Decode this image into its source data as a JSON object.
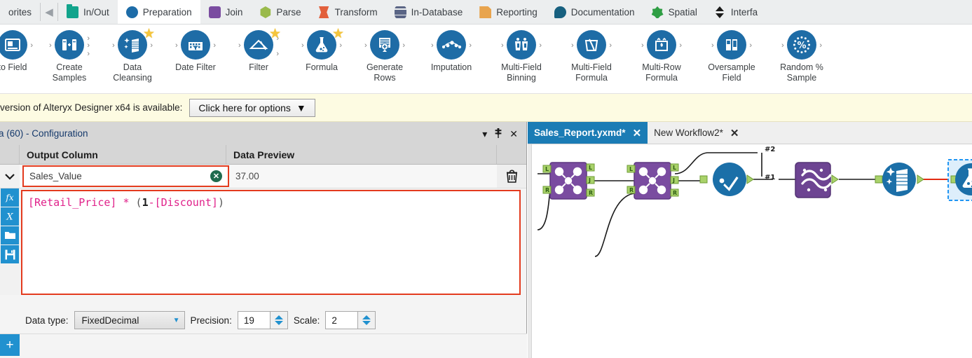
{
  "tool_palette": {
    "scroll_left_label": "◀",
    "categories": [
      {
        "label": "orites",
        "icon": "favorites-star-icon",
        "shape": "none",
        "active": false,
        "truncated": true
      },
      {
        "label": "In/Out",
        "icon": "folder-icon",
        "shape": "g-folder",
        "active": false
      },
      {
        "label": "Preparation",
        "icon": "circle-icon",
        "shape": "g-circle-blue",
        "active": true
      },
      {
        "label": "Join",
        "icon": "square-icon",
        "shape": "g-square-purple",
        "active": false
      },
      {
        "label": "Parse",
        "icon": "hexagon-icon",
        "shape": "g-hex-green",
        "active": false
      },
      {
        "label": "Transform",
        "icon": "hourglass-icon",
        "shape": "g-transform",
        "active": false
      },
      {
        "label": "In-Database",
        "icon": "database-icon",
        "shape": "g-db",
        "active": false
      },
      {
        "label": "Reporting",
        "icon": "page-icon",
        "shape": "g-report",
        "active": false
      },
      {
        "label": "Documentation",
        "icon": "speech-bubble-icon",
        "shape": "g-speech",
        "active": false
      },
      {
        "label": "Spatial",
        "icon": "globe-icon",
        "shape": "g-spatial",
        "active": false
      },
      {
        "label": "Interfa",
        "icon": "updown-arrows-icon",
        "shape": "g-interface",
        "active": false,
        "truncated": true
      }
    ]
  },
  "ribbon": {
    "tools": [
      {
        "label": "to Field",
        "icon": "auto-field-icon",
        "favorite": false,
        "anchors": "right",
        "truncated": true
      },
      {
        "label": "Create\nSamples",
        "icon": "create-samples-icon",
        "favorite": false,
        "anchors": "both-multi"
      },
      {
        "label": "Data\nCleansing",
        "icon": "data-cleansing-icon",
        "favorite": true,
        "anchors": "both"
      },
      {
        "label": "Date Filter",
        "icon": "date-filter-icon",
        "favorite": false,
        "anchors": "both"
      },
      {
        "label": "Filter",
        "icon": "filter-icon",
        "favorite": true,
        "anchors": "both-multi"
      },
      {
        "label": "Formula",
        "icon": "formula-flask-icon",
        "favorite": true,
        "anchors": "both"
      },
      {
        "label": "Generate\nRows",
        "icon": "generate-rows-icon",
        "favorite": false,
        "anchors": "both"
      },
      {
        "label": "Imputation",
        "icon": "imputation-icon",
        "favorite": false,
        "anchors": "both"
      },
      {
        "label": "Multi-Field\nBinning",
        "icon": "multi-field-binning-icon",
        "favorite": false,
        "anchors": "both"
      },
      {
        "label": "Multi-Field\nFormula",
        "icon": "multi-field-formula-icon",
        "favorite": false,
        "anchors": "both"
      },
      {
        "label": "Multi-Row\nFormula",
        "icon": "multi-row-formula-icon",
        "favorite": false,
        "anchors": "both"
      },
      {
        "label": "Oversample\nField",
        "icon": "oversample-field-icon",
        "favorite": false,
        "anchors": "both"
      },
      {
        "label": "Random %\nSample",
        "icon": "random-sample-icon",
        "favorite": false,
        "anchors": "both"
      }
    ]
  },
  "update_bar": {
    "message": "version of Alteryx Designer x64 is available:",
    "button_label": "Click here for options",
    "button_caret": "▼"
  },
  "config_panel": {
    "title": "a (60) - Configuration",
    "window_buttons": {
      "menu": "▾",
      "pin": "📌",
      "close": "✕"
    },
    "grid_headers": {
      "output_column": "Output Column",
      "data_preview": "Data Preview"
    },
    "row": {
      "expander": "⌄",
      "output_column_value": "Sales_Value",
      "clear_icon": "✕",
      "data_preview_value": "37.00",
      "delete_icon": "trash-icon"
    },
    "side_buttons": [
      {
        "icon": "fx-icon",
        "label": "fx"
      },
      {
        "icon": "variable-x-icon",
        "label": "X"
      },
      {
        "icon": "open-folder-icon",
        "label": "folder"
      },
      {
        "icon": "save-disk-icon",
        "label": "save"
      }
    ],
    "formula": {
      "raw": "[Retail_Price] * (1-[Discount])",
      "tokens": [
        {
          "text": "[Retail_Price]",
          "type": "field"
        },
        {
          "text": " ",
          "type": "space"
        },
        {
          "text": "*",
          "type": "op"
        },
        {
          "text": " ",
          "type": "space"
        },
        {
          "text": "(",
          "type": "paren"
        },
        {
          "text": "1",
          "type": "num"
        },
        {
          "text": "-",
          "type": "op"
        },
        {
          "text": "[Discount]",
          "type": "field"
        },
        {
          "text": ")",
          "type": "paren"
        }
      ]
    },
    "settings": {
      "data_type_label": "Data type:",
      "data_type_value": "FixedDecimal",
      "precision_label": "Precision:",
      "precision_value": "19",
      "scale_label": "Scale:",
      "scale_value": "2"
    },
    "add_button_label": "+"
  },
  "workflow": {
    "tabs": [
      {
        "label": "Sales_Report.yxmd*",
        "active": true,
        "close": "✕"
      },
      {
        "label": "New Workflow2*",
        "active": false,
        "close": "✕"
      }
    ],
    "canvas": {
      "connection_labels": [
        "#2",
        "#1"
      ],
      "nodes": [
        {
          "name": "join-tool-1",
          "type": "join",
          "color": "#7a4ca0",
          "anchors_in": [
            "L",
            "R"
          ],
          "anchors_out": [
            "L",
            "J",
            "R"
          ]
        },
        {
          "name": "join-tool-2",
          "type": "join",
          "color": "#7a4ca0",
          "anchors_in": [
            "L",
            "R"
          ],
          "anchors_out": [
            "L",
            "J",
            "R"
          ]
        },
        {
          "name": "sort-tool",
          "type": "sort",
          "color": "#1b6fa8"
        },
        {
          "name": "union-tool",
          "type": "union",
          "color": "#6d4492"
        },
        {
          "name": "data-cleansing-tool",
          "type": "data-cleansing",
          "color": "#1b6fa8"
        },
        {
          "name": "formula-tool",
          "type": "formula",
          "color": "#1b6fa8",
          "selected": true,
          "error": true
        }
      ]
    }
  },
  "colors": {
    "accent_blue": "#1e6ca6",
    "error_red": "#e33b1e",
    "highlight_yellow": "#fdfbe2",
    "field_pink": "#e0218a",
    "tab_active_blue": "#1b7cb5"
  }
}
